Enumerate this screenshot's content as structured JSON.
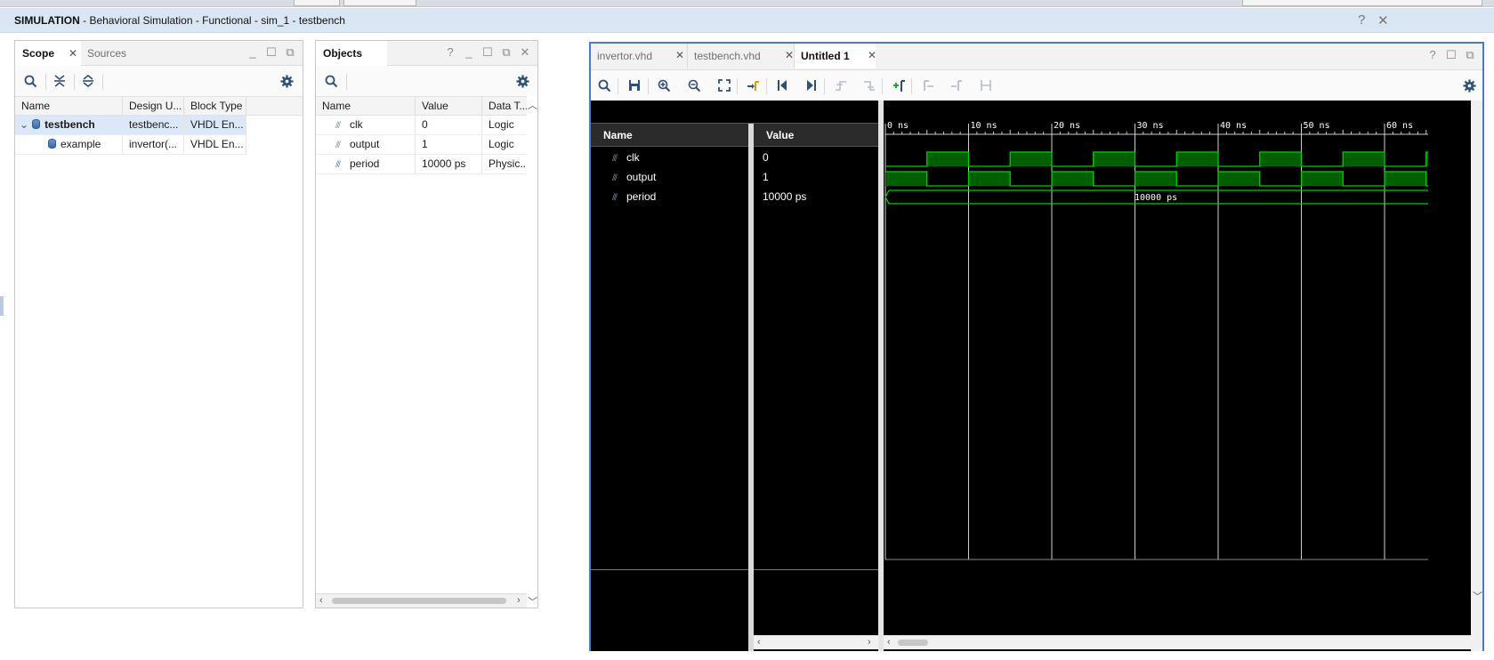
{
  "window": {
    "title_bold": "SIMULATION",
    "title_rest": " - Behavioral Simulation - Functional - sim_1 - testbench",
    "help_glyph": "?",
    "close_glyph": "✕"
  },
  "scope_panel": {
    "tabs": [
      "Scope",
      "Sources"
    ],
    "close_glyph": "✕",
    "columns": [
      "Name",
      "Design U...",
      "Block Type"
    ],
    "rows": [
      {
        "name": "testbench",
        "design_unit": "testbenc...",
        "block_type": "VHDL En...",
        "expanded_glyph": "⌄"
      },
      {
        "name": "example",
        "design_unit": "invertor(...",
        "block_type": "VHDL En..."
      }
    ]
  },
  "objects_panel": {
    "title": "Objects",
    "help_glyph": "?",
    "columns": [
      "Name",
      "Value",
      "Data T..."
    ],
    "rows": [
      {
        "name": "clk",
        "value": "0",
        "type": "Logic"
      },
      {
        "name": "output",
        "value": "1",
        "type": "Logic"
      },
      {
        "name": "period",
        "value": "10000 ps",
        "type": "Physic..."
      }
    ]
  },
  "wave_panel": {
    "tabs": [
      "invertor.vhd",
      "testbench.vhd",
      "Untitled 1"
    ],
    "active_tab": 2,
    "close_glyph": "✕",
    "help_glyph": "?",
    "name_header": "Name",
    "value_header": "Value",
    "signals": [
      {
        "name": "clk",
        "value": "0"
      },
      {
        "name": "output",
        "value": "1"
      },
      {
        "name": "period",
        "value": "10000 ps"
      }
    ],
    "time_ticks": [
      "0 ns",
      "10 ns",
      "20 ns",
      "30 ns",
      "40 ns",
      "50 ns",
      "60 ns"
    ],
    "bus_value_label": "10000 ps",
    "wave_color": "#00d000",
    "fill_color": "#006000"
  }
}
